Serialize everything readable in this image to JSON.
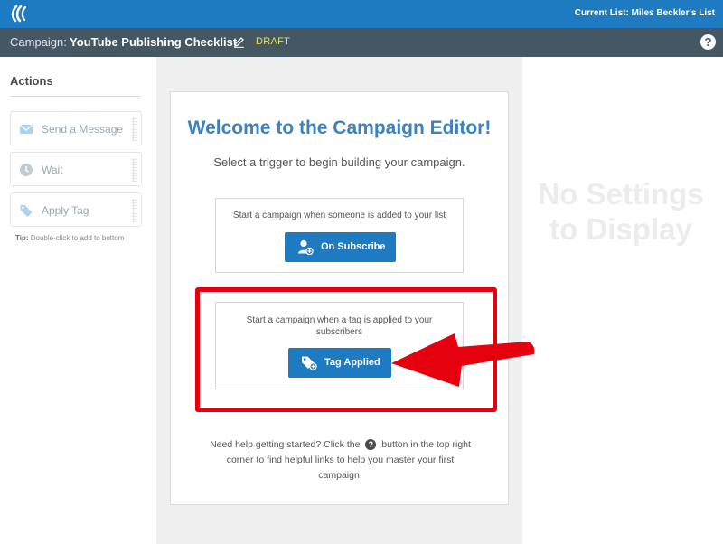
{
  "topbar": {
    "current_list": "Current List: Miles Beckler's List",
    "logo_icon": "aweber-logo-icon",
    "color": "#1f7bc1"
  },
  "campaign_bar": {
    "prefix": "Campaign:",
    "name": "YouTube Publishing Checklist",
    "status": "DRAFT",
    "edit_icon": "pencil-icon",
    "help_icon": "question-circle-icon",
    "help_glyph": "?"
  },
  "sidebar": {
    "title": "Actions",
    "items": [
      {
        "label": "Send a Message",
        "icon": "envelope-icon"
      },
      {
        "label": "Wait",
        "icon": "clock-icon"
      },
      {
        "label": "Apply Tag",
        "icon": "tag-icon"
      }
    ],
    "tip_bold": "Tip:",
    "tip_text": "Double-click to add to bottom"
  },
  "editor": {
    "title": "Welcome to the Campaign Editor!",
    "subtitle": "Select a trigger to begin building your campaign.",
    "triggers": [
      {
        "description": "Start a campaign when someone is added to your list",
        "button_label": "On Subscribe",
        "icon": "add-user-icon"
      },
      {
        "description": "Start a campaign when a tag is applied to your subscribers",
        "button_label": "Tag Applied",
        "icon": "add-tag-icon"
      }
    ],
    "help_before": "Need help getting started? Click the",
    "help_glyph": "?",
    "help_after": "button in the top right corner to find helpful links to help you master your first campaign."
  },
  "settings_panel": {
    "empty_text": "No Settings to Display"
  },
  "annotation": {
    "color": "#e5000e"
  }
}
